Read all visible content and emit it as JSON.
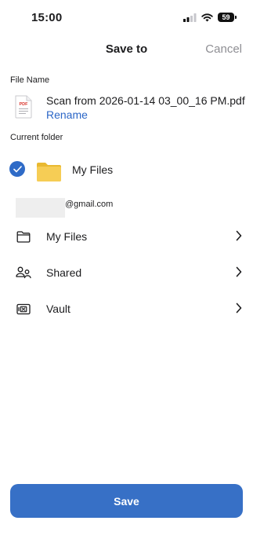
{
  "status_bar": {
    "time": "15:00",
    "battery": "59"
  },
  "nav": {
    "title": "Save to",
    "cancel_label": "Cancel"
  },
  "file": {
    "section_label": "File Name",
    "pdf_badge": "PDF",
    "name": "Scan from 2026-01-14 03_00_16 PM.pdf",
    "rename_label": "Rename"
  },
  "current_folder": {
    "section_label": "Current folder",
    "name": "My Files"
  },
  "account": {
    "email_suffix": "@gmail.com"
  },
  "locations": [
    {
      "label": "My Files",
      "icon": "folder-outline-icon"
    },
    {
      "label": "Shared",
      "icon": "people-icon"
    },
    {
      "label": "Vault",
      "icon": "vault-icon"
    }
  ],
  "actions": {
    "save_label": "Save"
  },
  "colors": {
    "accent": "#3770c6",
    "link": "#2b66c7",
    "folder": "#f5c542",
    "muted": "#8e8e93"
  }
}
